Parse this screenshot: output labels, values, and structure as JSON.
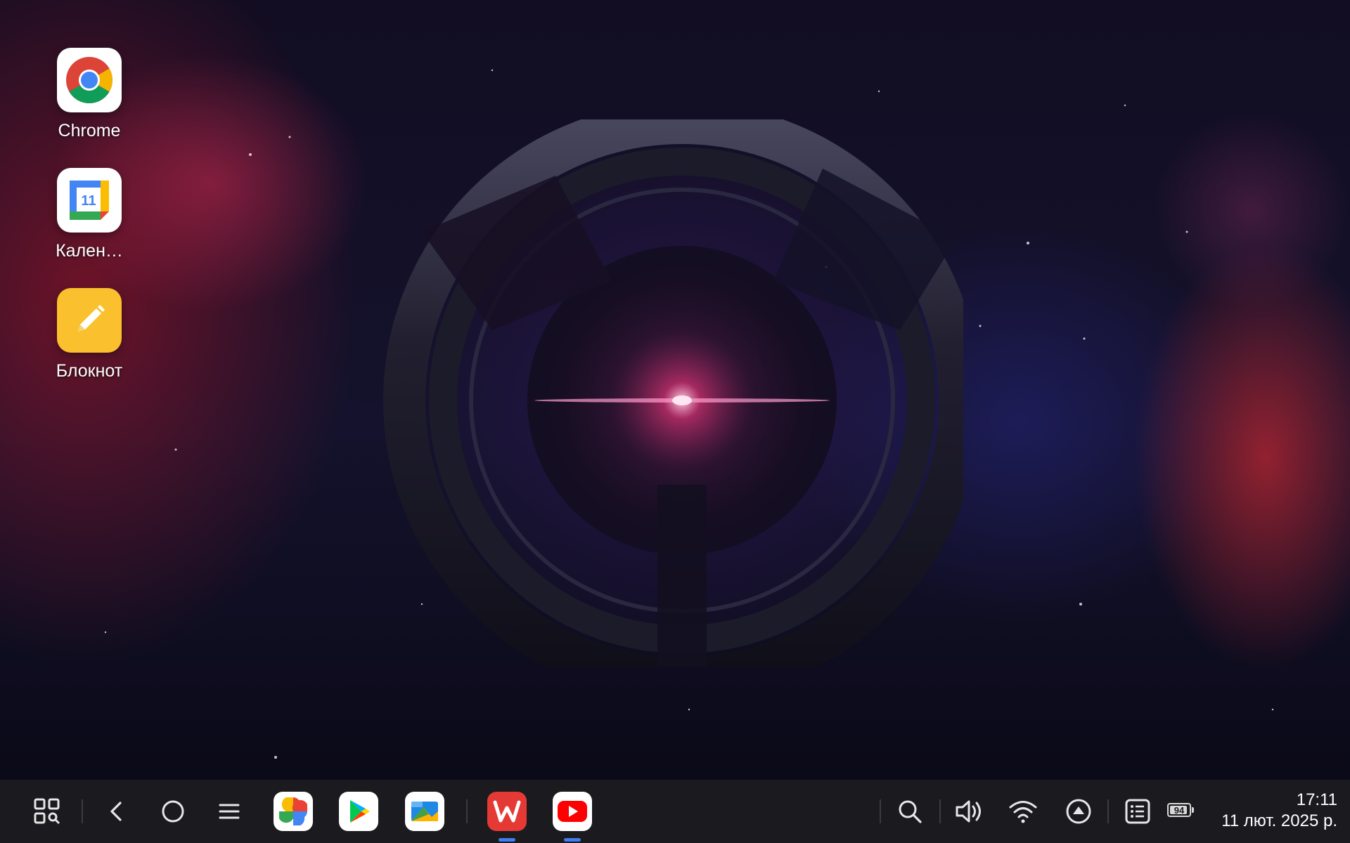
{
  "desktop": {
    "icons": [
      {
        "label": "Chrome",
        "icon": "chrome-icon"
      },
      {
        "label": "Кален…",
        "icon": "calendar-icon",
        "badge": "11"
      },
      {
        "label": "Блокнот",
        "icon": "notepad-icon"
      }
    ]
  },
  "taskbar": {
    "system_buttons": [
      "app-drawer-icon",
      "back-icon",
      "home-icon",
      "menu-icon"
    ],
    "pinned_apps": [
      "photos-icon",
      "play-store-icon",
      "files-icon",
      "wps-office-icon",
      "youtube-icon"
    ],
    "running_apps": [
      "wps-office-icon",
      "youtube-icon"
    ],
    "status_icons": [
      "search-icon",
      "volume-icon",
      "wifi-icon",
      "upload-icon",
      "notification-list-icon",
      "battery-icon"
    ],
    "battery": {
      "level": 94,
      "label": "94"
    },
    "clock": {
      "time": "17:11",
      "date": "11 лют. 2025 р."
    },
    "colors": {
      "background": "#1b1b1f",
      "indicator": "#3f7ef0"
    }
  }
}
